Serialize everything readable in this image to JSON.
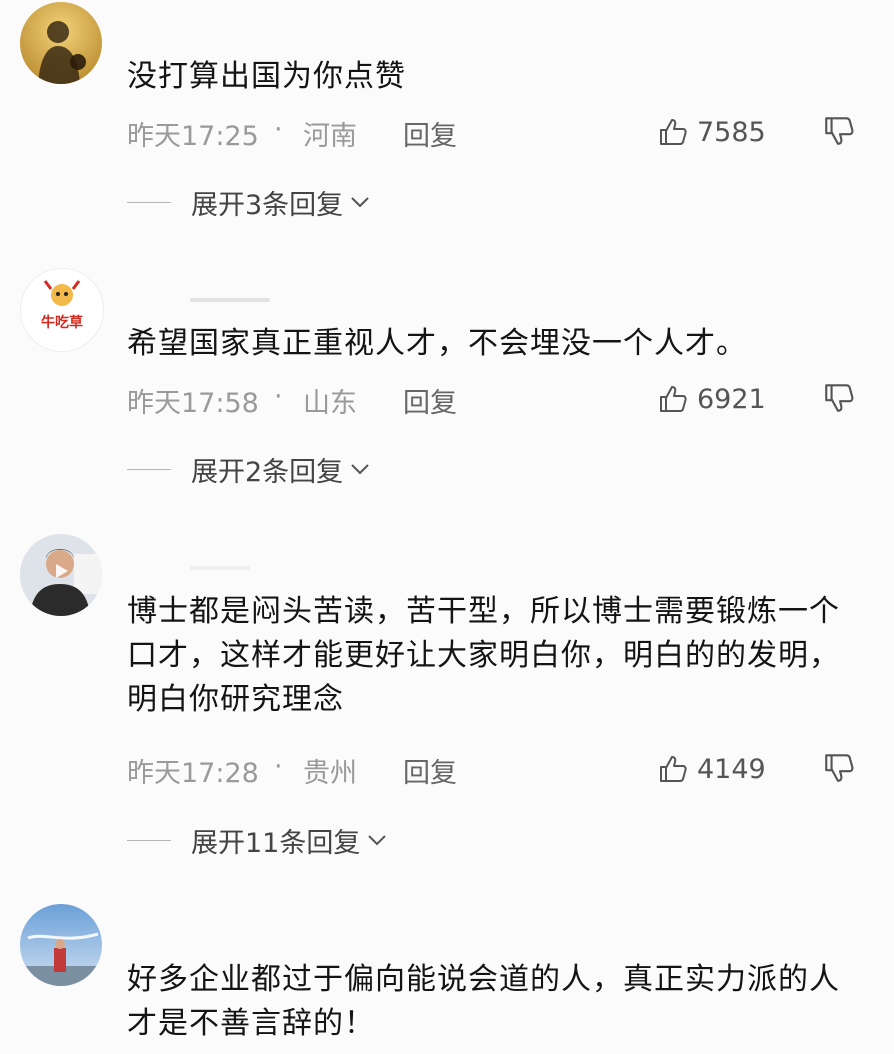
{
  "comments": [
    {
      "text": "没打算出国为你点赞",
      "time": "昨天17:25",
      "dot": "·",
      "location": "河南",
      "reply_label": "回复",
      "likes": "7585",
      "expand_label": "展开3条回复"
    },
    {
      "avatar_text": "牛吃草",
      "text": "希望国家真正重视人才，不会埋没一个人才。",
      "time": "昨天17:58",
      "dot": "·",
      "location": "山东",
      "reply_label": "回复",
      "likes": "6921",
      "expand_label": "展开2条回复"
    },
    {
      "text": "博士都是闷头苦读，苦干型，所以博士需要锻炼一个口才，这样才能更好让大家明白你，明白的的发明，明白你研究理念",
      "time": "昨天17:28",
      "dot": "·",
      "location": "贵州",
      "reply_label": "回复",
      "likes": "4149",
      "expand_label": "展开11条回复"
    },
    {
      "text": "好多企业都过于偏向能说会道的人，真正实力派的人才是不善言辞的！"
    }
  ],
  "colors": {
    "background": "#fbfbfb",
    "text": "#141414",
    "meta": "#9a9a9a",
    "avatar_brand_red": "#d42a20"
  },
  "icons": [
    "thumbs-up-icon",
    "thumbs-down-icon",
    "chevron-down-icon"
  ]
}
